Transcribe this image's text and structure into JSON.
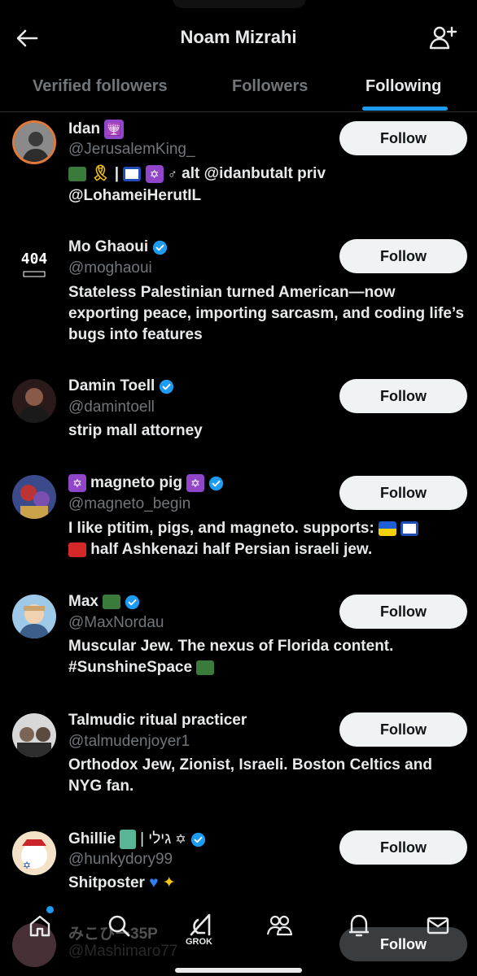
{
  "header": {
    "title": "Noam Mizrahi"
  },
  "tabs": [
    {
      "label": "Verified followers"
    },
    {
      "label": "Followers"
    },
    {
      "label": "Following"
    }
  ],
  "users": [
    {
      "name": "Idan",
      "handle": "@JerusalemKing_",
      "bio_line1": "| ",
      "bio_tail": "alt @idanbutalt priv",
      "bio_line2": "@LohameiHerutIL",
      "follow": "Follow"
    },
    {
      "name": "Mo Ghaoui",
      "handle": "@moghaoui",
      "bio": "Stateless Palestinian turned American—now exporting peace, importing sarcasm, and coding life’s bugs into features",
      "follow": "Follow",
      "avatar_text": "404"
    },
    {
      "name": "Damin Toell",
      "handle": "@damintoell",
      "bio": "strip mall attorney",
      "follow": "Follow"
    },
    {
      "name": "magneto pig",
      "handle": "@magneto_begin",
      "bio_line1": "I like ptitim, pigs, and magneto. supports:",
      "bio_line2": "half Ashkenazi half Persian israeli jew.",
      "follow": "Follow"
    },
    {
      "name": "Max",
      "handle": "@MaxNordau",
      "bio_line1": "Muscular Jew. The nexus of Florida content.",
      "bio_line2": "#SunshineSpace",
      "follow": "Follow"
    },
    {
      "name": "Talmudic ritual practicer",
      "handle": "@talmudenjoyer1",
      "bio": "Orthodox Jew, Zionist, Israeli. Boston Celtics and NYG fan.",
      "follow": "Follow"
    },
    {
      "name": "Ghillie",
      "name_suffix": "| גילי",
      "handle": "@hunkydory99",
      "bio": "Shitposter",
      "follow": "Follow"
    },
    {
      "name": "みこひー35P",
      "handle": "@Mashimaro77",
      "follow": "Follow"
    }
  ],
  "nav": {
    "grok_label": "GROK"
  },
  "colors": {
    "accent": "#1d9bf0",
    "background": "#000000",
    "muted": "#71767b"
  }
}
